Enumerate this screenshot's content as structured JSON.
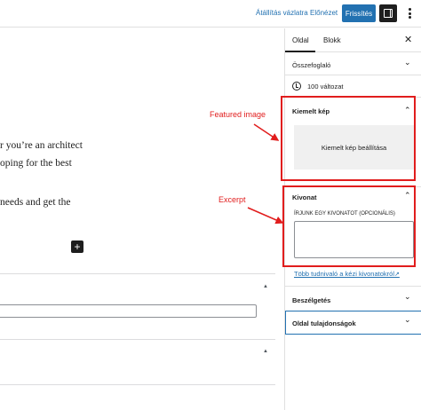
{
  "toolbar": {
    "draft_label": "Átállítás vázlatra",
    "preview_label": "Előnézet",
    "update_label": "Frissítés"
  },
  "editor": {
    "paragraph_line_1": "r you’re an architect",
    "paragraph_line_2": "oping for the best",
    "paragraph_line_3": "needs and get the",
    "inserter_symbol": "+"
  },
  "sidebar": {
    "tabs": [
      {
        "label": "Oldal",
        "active": true
      },
      {
        "label": "Blokk",
        "active": false
      }
    ],
    "close_symbol": "✕",
    "summary": {
      "title": "Összefoglaló",
      "caret": "⌄"
    },
    "revisions": {
      "text": "100 változat",
      "icon": "history-icon"
    },
    "featured_image": {
      "title": "Kiemelt kép",
      "caret": "⌃",
      "button_label": "Kiemelt kép beállítása"
    },
    "excerpt": {
      "title": "Kivonat",
      "caret": "⌃",
      "field_label": "ÍRJUNK EGY KIVONATOT (OPCIONÁLIS)",
      "field_value": "",
      "link_text": "Több tudnivaló a kézi kivonatokról",
      "link_icon": "↗"
    },
    "discussion": {
      "title": "Beszélgetés",
      "caret": "⌄"
    },
    "page_attributes": {
      "title": "Oldal tulajdonságok",
      "caret": "⌄"
    }
  },
  "meta_boxes": {
    "caret_1": "▲",
    "caret_2": "▲"
  },
  "annotations": {
    "featured_label": "Featured image",
    "excerpt_label": "Excerpt",
    "color": "#e11d1d"
  },
  "colors": {
    "accent": "#2271b1",
    "dark": "#1e1e1e"
  }
}
